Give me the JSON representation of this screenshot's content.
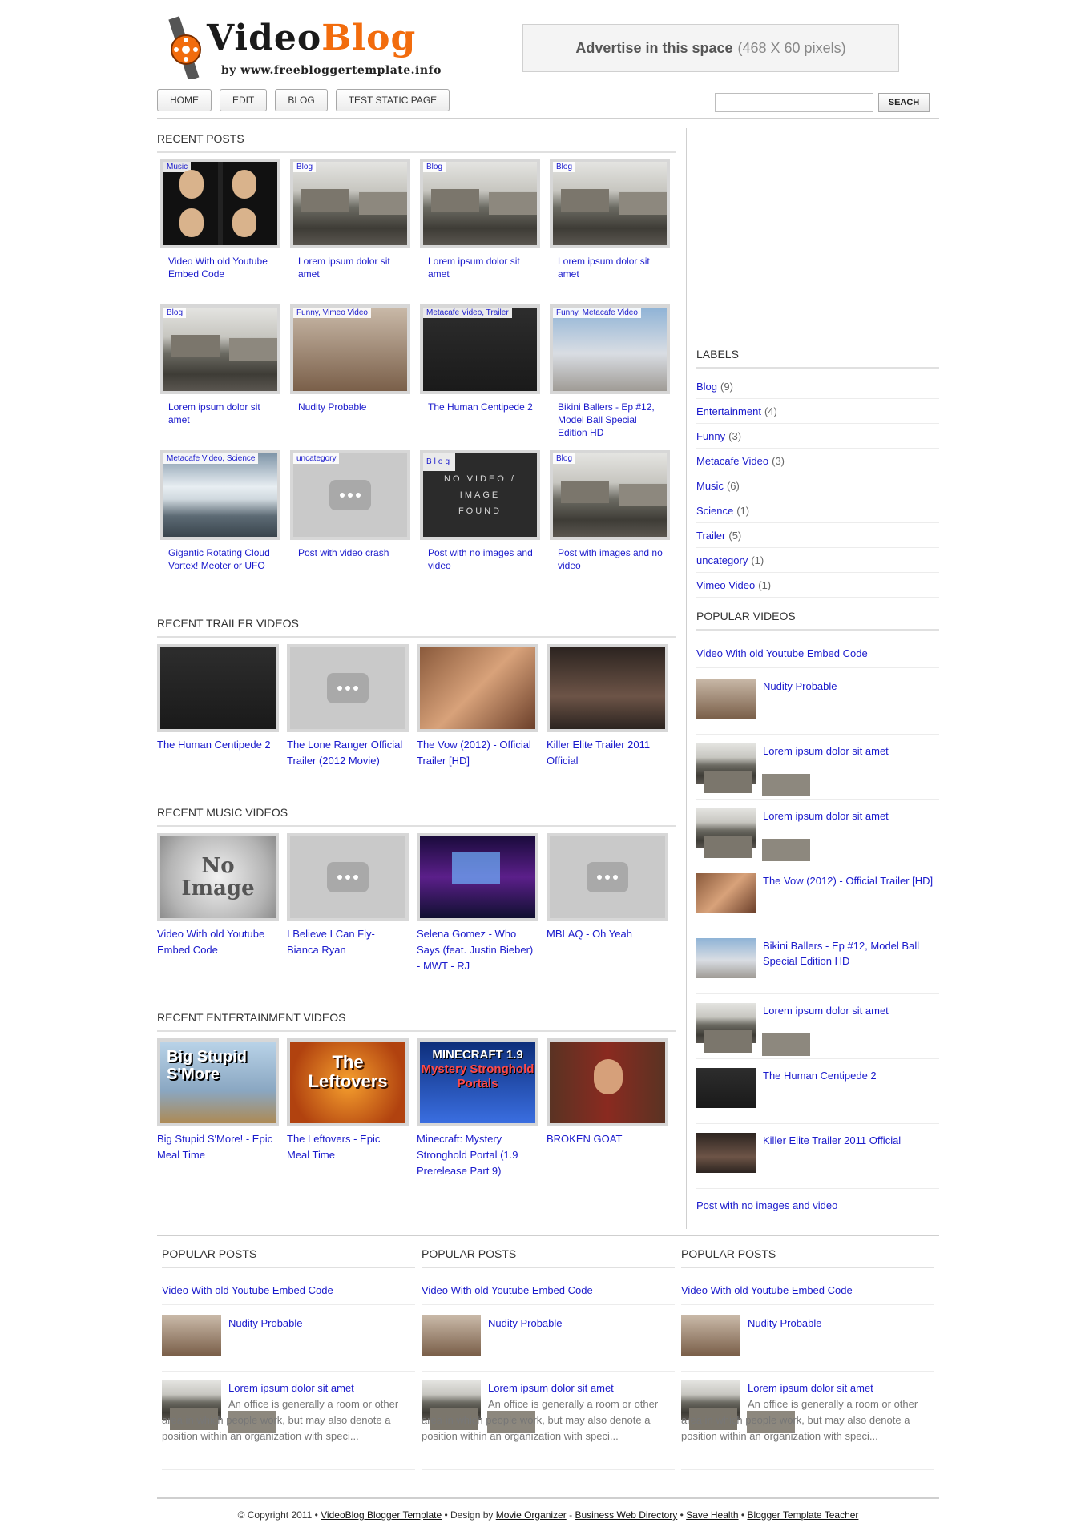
{
  "logo": {
    "title_dark": "Video",
    "title_orange": "Blog",
    "byline": "by www.freebloggertemplate.info"
  },
  "ad": {
    "text": "Advertise in this space",
    "size": "(468 X 60 pixels)"
  },
  "nav": {
    "items": [
      "HOME",
      "EDIT",
      "BLOG",
      "TEST STATIC PAGE"
    ]
  },
  "search": {
    "placeholder": "",
    "button": "SEACH"
  },
  "sections": {
    "recent_posts": "RECENT POSTS",
    "trailer": "RECENT TRAILER VIDEOS",
    "music": "RECENT MUSIC VIDEOS",
    "entertainment": "RECENT ENTERTAINMENT VIDEOS"
  },
  "recent_posts": [
    {
      "tag": "Music",
      "title": "Video With old Youtube Embed Code"
    },
    {
      "tag": "Blog",
      "title": "Lorem ipsum dolor sit amet"
    },
    {
      "tag": "Blog",
      "title": "Lorem ipsum dolor sit amet"
    },
    {
      "tag": "Blog",
      "title": "Lorem ipsum dolor sit amet"
    },
    {
      "tag": "Blog",
      "title": "Lorem ipsum dolor sit amet"
    },
    {
      "tag": "Funny, Vimeo Video",
      "title": "Nudity Probable"
    },
    {
      "tag": "Metacafe Video, Trailer",
      "title": "The Human Centipede 2"
    },
    {
      "tag": "Funny, Metacafe Video",
      "title": "Bikini Ballers - Ep #12, Model Ball Special Edition HD"
    },
    {
      "tag": "Metacafe Video, Science",
      "title": "Gigantic Rotating Cloud Vortex! Meoter or UFO"
    },
    {
      "tag": "uncategory",
      "title": "Post with video crash"
    },
    {
      "tag": "Blog",
      "title": "Post with no images and video",
      "thumb_text": "NO VIDEO / IMAGE FOUND"
    },
    {
      "tag": "Blog",
      "title": "Post with images and no video"
    }
  ],
  "trailer_videos": [
    {
      "title": "The Human Centipede 2"
    },
    {
      "title": "The Lone Ranger Official Trailer (2012 Movie)"
    },
    {
      "title": "The Vow (2012) - Official Trailer [HD]"
    },
    {
      "title": "Killer Elite Trailer 2011 Official"
    }
  ],
  "music_videos": [
    {
      "title": "Video With old Youtube Embed Code",
      "thumb_text": "No Image"
    },
    {
      "title": "I Believe I Can Fly-Bianca Ryan"
    },
    {
      "title": "Selena Gomez - Who Says (feat. Justin Bieber) - MWT - RJ"
    },
    {
      "title": "MBLAQ - Oh Yeah"
    }
  ],
  "entertainment_videos": [
    {
      "title": "Big Stupid S'More! - Epic Meal Time",
      "thumb_text": "Big Stupid S'More"
    },
    {
      "title": "The Leftovers - Epic Meal Time",
      "thumb_text": "The Leftovers"
    },
    {
      "title": "Minecraft: Mystery Stronghold Portal (1.9 Prerelease Part 9)",
      "thumb_text_a": "MINECRAFT 1.9",
      "thumb_text_b": "Mystery Stronghold Portals"
    },
    {
      "title": "BROKEN GOAT"
    }
  ],
  "sidebar": {
    "labels_title": "LABELS",
    "labels": [
      {
        "name": "Blog",
        "count": "(9)"
      },
      {
        "name": "Entertainment",
        "count": "(4)"
      },
      {
        "name": "Funny",
        "count": "(3)"
      },
      {
        "name": "Metacafe Video",
        "count": "(3)"
      },
      {
        "name": "Music",
        "count": "(6)"
      },
      {
        "name": "Science",
        "count": "(1)"
      },
      {
        "name": "Trailer",
        "count": "(5)"
      },
      {
        "name": "uncategory",
        "count": "(1)"
      },
      {
        "name": "Vimeo Video",
        "count": "(1)"
      }
    ],
    "popular_title": "POPULAR VIDEOS",
    "popular": [
      "Video With old Youtube Embed Code",
      "Nudity Probable",
      "Lorem ipsum dolor sit amet",
      "Lorem ipsum dolor sit amet",
      "The Vow (2012) - Official Trailer [HD]",
      "Bikini Ballers - Ep #12, Model Ball Special Edition HD",
      "Lorem ipsum dolor sit amet",
      "The Human Centipede 2",
      "Killer Elite Trailer 2011 Official",
      "Post with no images and video"
    ]
  },
  "footer_popular": {
    "title": "POPULAR POSTS",
    "items": [
      "Video With old Youtube Embed Code",
      "Nudity Probable",
      "Lorem ipsum dolor sit amet"
    ],
    "desc": "An office is generally a room or other area in which people work, but may also denote a position within an organization with speci..."
  },
  "copyright": {
    "prefix": "© Copyright 2011 •",
    "template": "VideoBlog Blogger Template",
    "design_by": "• Design by",
    "movie": "Movie Organizer",
    "sep1": "-",
    "bwd": "Business Web Directory",
    "sep2": "•",
    "save": "Save Health",
    "sep3": "•",
    "teacher": "Blogger Template Teacher"
  }
}
